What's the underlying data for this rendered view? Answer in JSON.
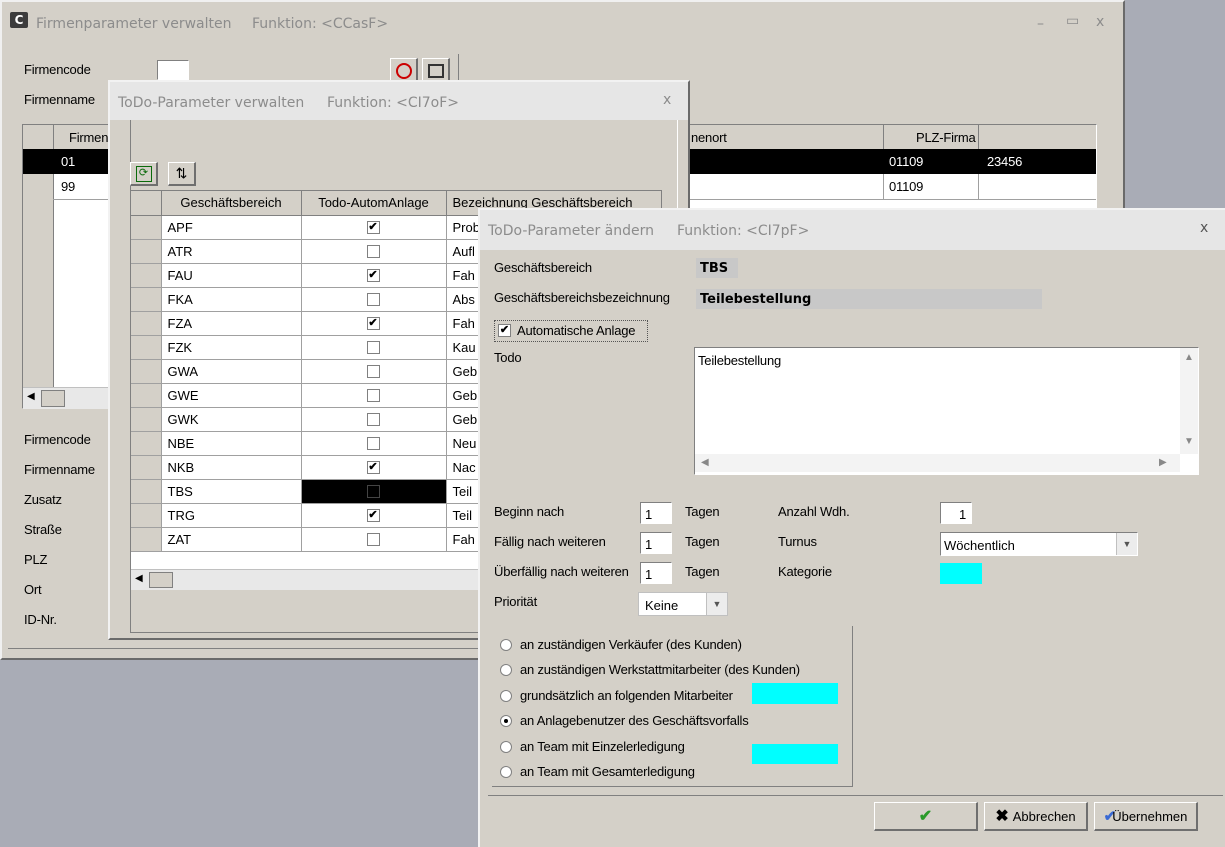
{
  "firm_window": {
    "title": "Firmenparameter verwalten",
    "function": "Funktion: <CCasF>",
    "labels": {
      "firmencode": "Firmencode",
      "firmenname": "Firmenname",
      "firmencode2": "Firmencode",
      "firmenname2": "Firmenname",
      "zusatz": "Zusatz",
      "strasse": "Straße",
      "plz": "PLZ",
      "ort": "Ort",
      "idnr": "ID-Nr."
    },
    "grid": {
      "col_firma": "Firmen",
      "col_ort": "nenort",
      "col_plz": "PLZ-Firma",
      "rows": [
        {
          "code": "01",
          "plz": "01109",
          "extra": "23456"
        },
        {
          "code": "99",
          "plz": "01109",
          "extra": ""
        }
      ]
    }
  },
  "todo_window": {
    "title": "ToDo-Parameter verwalten",
    "function": "Funktion: <CI7oF>",
    "close": "x",
    "columns": [
      "Geschäftsbereich",
      "Todo-AutomAnlage",
      "Bezeichnung Geschäftsbereich"
    ],
    "rows": [
      {
        "code": "APF",
        "auto": true,
        "desc": "Prob"
      },
      {
        "code": "ATR",
        "auto": false,
        "desc": "Aufl"
      },
      {
        "code": "FAU",
        "auto": true,
        "desc": "Fah"
      },
      {
        "code": "FKA",
        "auto": false,
        "desc": "Abs"
      },
      {
        "code": "FZA",
        "auto": true,
        "desc": "Fah"
      },
      {
        "code": "FZK",
        "auto": false,
        "desc": "Kau"
      },
      {
        "code": "GWA",
        "auto": false,
        "desc": "Geb"
      },
      {
        "code": "GWE",
        "auto": false,
        "desc": "Geb"
      },
      {
        "code": "GWK",
        "auto": false,
        "desc": "Geb"
      },
      {
        "code": "NBE",
        "auto": false,
        "desc": "Neu"
      },
      {
        "code": "NKB",
        "auto": true,
        "desc": "Nac"
      },
      {
        "code": "TBS",
        "auto": false,
        "desc": "Teil"
      },
      {
        "code": "TRG",
        "auto": true,
        "desc": "Teil"
      },
      {
        "code": "ZAT",
        "auto": false,
        "desc": "Fah"
      }
    ]
  },
  "edit_dialog": {
    "title": "ToDo-Parameter ändern",
    "function": "Funktion: <CI7pF>",
    "close": "x",
    "geschaeftsbereich_label": "Geschäftsbereich",
    "geschaeftsbereich_value": "TBS",
    "bezeichnung_label": "Geschäftsbereichsbezeichnung",
    "bezeichnung_value": "Teilebestellung",
    "auto_anlage_label": "Automatische Anlage",
    "auto_anlage_checked": true,
    "todo_label": "Todo",
    "todo_value": "Teilebestellung",
    "beginn_label": "Beginn  nach",
    "beginn_value": "1",
    "faellig_label": "Fällig nach weiteren",
    "faellig_value": "1",
    "ueberfaellig_label": "Überfällig nach weiteren",
    "ueberfaellig_value": "1",
    "tagen": "Tagen",
    "anzahl_label": "Anzahl Wdh.",
    "anzahl_value": "1",
    "turnus_label": "Turnus",
    "turnus_value": "Wöchentlich",
    "kategorie_label": "Kategorie",
    "prioritaet_label": "Priorität",
    "prioritaet_value": "Keine",
    "radios": [
      {
        "label": "an zuständigen Verkäufer (des Kunden)",
        "checked": false
      },
      {
        "label": "an zuständigen Werkstattmitarbeiter (des Kunden)",
        "checked": false
      },
      {
        "label": "grundsätzlich an folgenden Mitarbeiter",
        "checked": false
      },
      {
        "label": "an Anlagebenutzer des Geschäftsvorfalls",
        "checked": true
      },
      {
        "label": "an Team mit Einzelerledigung",
        "checked": false
      },
      {
        "label": "an Team mit Gesamterledigung",
        "checked": false
      }
    ],
    "buttons": {
      "abbrechen": "Abbrechen",
      "uebernehmen": "Übernehmen"
    },
    "accent_color": "#00ffff"
  }
}
